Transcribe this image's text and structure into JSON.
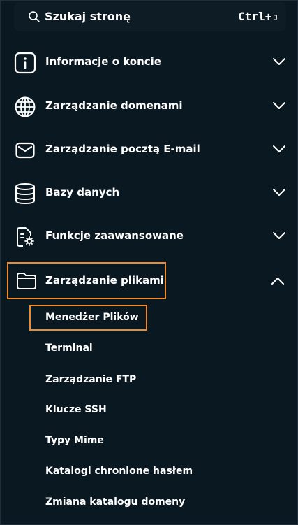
{
  "search": {
    "label": "Szukaj stronę",
    "shortcut": "Ctrl+",
    "shortcut_key": "J"
  },
  "menu": [
    {
      "label": "Informacje o koncie",
      "icon": "info-icon"
    },
    {
      "label": "Zarządzanie domenami",
      "icon": "globe-icon"
    },
    {
      "label": "Zarządzanie pocztą E-mail",
      "icon": "mail-icon"
    },
    {
      "label": "Bazy danych",
      "icon": "database-icon"
    },
    {
      "label": "Funkcje zaawansowane",
      "icon": "advanced-settings-icon"
    },
    {
      "label": "Zarządzanie plikami",
      "icon": "folder-icon",
      "expanded": true
    }
  ],
  "submenu": [
    "Menedżer Plików",
    "Terminal",
    "Zarządzanie FTP",
    "Klucze SSH",
    "Typy Mime",
    "Katalogi chronione hasłem",
    "Zmiana katalogu domeny"
  ],
  "colors": {
    "background": "#0a1821",
    "highlight": "#ef8b2c",
    "text": "#ffffff"
  }
}
